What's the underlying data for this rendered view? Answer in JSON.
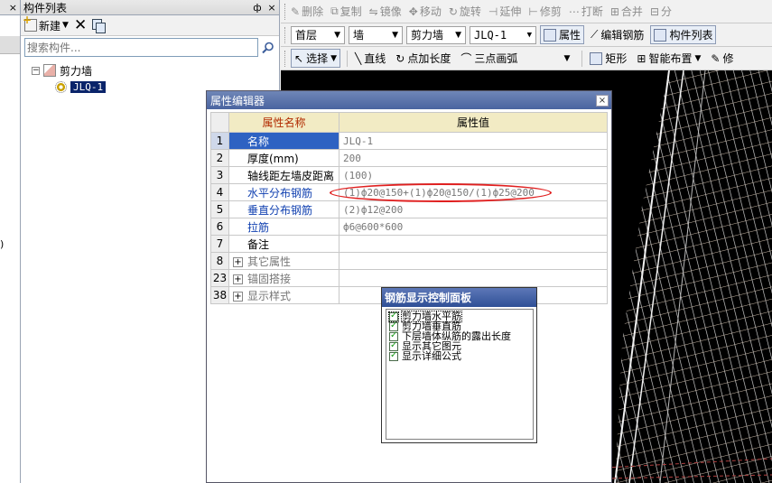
{
  "left_strip": {
    "close_glyph": "×",
    "paren": ")"
  },
  "component_panel": {
    "title": "构件列表",
    "pin_glyph": "ф",
    "close_glyph": "×",
    "new_label": "新建",
    "search_placeholder": "搜索构件...",
    "tree": {
      "group_label": "剪力墙",
      "item_label": "JLQ-1"
    }
  },
  "toolbar1": {
    "items": [
      "删除",
      "复制",
      "镜像",
      "移动",
      "旋转",
      "延伸",
      "修剪",
      "打断",
      "合并",
      "分"
    ]
  },
  "toolbar2": {
    "floor": "首层",
    "category": "墙",
    "type": "剪力墙",
    "component": "JLQ-1",
    "properties": "属性",
    "edit_rebar": "编辑钢筋",
    "component_list": "构件列表"
  },
  "toolbar3": {
    "select": "选择",
    "line": "直线",
    "point_length": "点加长度",
    "arc": "三点画弧",
    "rect": "矩形",
    "smart_layout": "智能布置",
    "more": "修"
  },
  "property_editor": {
    "title": "属性编辑器",
    "close_glyph": "×",
    "headers": {
      "name": "属性名称",
      "value": "属性值"
    },
    "rows": [
      {
        "num": "1",
        "name": "名称",
        "value": "JLQ-1",
        "color": "black"
      },
      {
        "num": "2",
        "name": "厚度(mm)",
        "value": "200",
        "color": "black"
      },
      {
        "num": "3",
        "name": "轴线距左墙皮距离",
        "value": "(100)",
        "color": "black"
      },
      {
        "num": "4",
        "name": "水平分布钢筋",
        "value": "(1)ф20@150+(1)ф20@150/(1)ф25@200",
        "color": "blue"
      },
      {
        "num": "5",
        "name": "垂直分布钢筋",
        "value": "(2)ф12@200",
        "color": "blue"
      },
      {
        "num": "6",
        "name": "拉筋",
        "value": "ф6@600*600",
        "color": "blue"
      },
      {
        "num": "7",
        "name": "备注",
        "value": "",
        "color": "black"
      }
    ],
    "groups": [
      {
        "num": "8",
        "name": "其它属性"
      },
      {
        "num": "23",
        "name": "锚固搭接"
      },
      {
        "num": "38",
        "name": "显示样式"
      }
    ]
  },
  "rebar_panel": {
    "title": "钢筋显示控制面板",
    "items": [
      "剪力墙水平筋",
      "剪力墙垂直筋",
      "下层墙体纵筋的露出长度",
      "显示其它图元",
      "显示详细公式"
    ]
  }
}
